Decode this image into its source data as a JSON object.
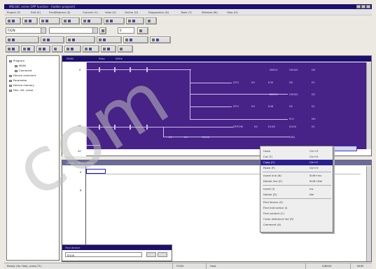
{
  "window": {
    "title": "MELSEC series GPP function - [ladder program]"
  },
  "menu": [
    "Project (F)",
    "Edit (E)",
    "Find/Replace (S)",
    "Convert (C)",
    "View (V)",
    "Online (O)",
    "Diagnostics (D)",
    "Tools (T)",
    "Window (W)",
    "Help (H)"
  ],
  "toolbar": {
    "plc_combo": "FX2N",
    "device_combo": "",
    "step_combo": "0"
  },
  "project_tree": [
    {
      "label": "Program",
      "indent": 0
    },
    {
      "label": "MAIN",
      "indent": 1
    },
    {
      "label": "Comment",
      "indent": 1
    },
    {
      "label": "Device comment",
      "indent": 0
    },
    {
      "label": "Parameter",
      "indent": 0
    },
    {
      "label": "Device memory",
      "indent": 0
    },
    {
      "label": "Dev. init. value",
      "indent": 0
    }
  ],
  "ladder_window": {
    "tabs": [
      "MAIN",
      "Step",
      "Write"
    ]
  },
  "ladder": {
    "step_numbers": [
      "0",
      "10",
      "20"
    ],
    "instructions": [
      {
        "row": 0,
        "text": "DMOV"
      },
      {
        "row": 0,
        "text": "H0000"
      },
      {
        "row": 0,
        "text": "D0"
      },
      {
        "row": 1,
        "text": "DTO"
      },
      {
        "row": 1,
        "text": "K0"
      },
      {
        "row": 1,
        "text": "K30"
      },
      {
        "row": 1,
        "text": "D0"
      },
      {
        "row": 1,
        "text": "K1"
      },
      {
        "row": 2,
        "text": "DMOV"
      },
      {
        "row": 2,
        "text": "H0000"
      },
      {
        "row": 2,
        "text": "D2"
      },
      {
        "row": 3,
        "text": "DTO"
      },
      {
        "row": 3,
        "text": "K0"
      },
      {
        "row": 3,
        "text": "K48"
      },
      {
        "row": 3,
        "text": "D2"
      },
      {
        "row": 3,
        "text": "K1"
      },
      {
        "row": 4,
        "text": "PLS"
      },
      {
        "row": 4,
        "text": "M0"
      },
      {
        "row": 5,
        "text": "DFROM"
      },
      {
        "row": 5,
        "text": "K0"
      },
      {
        "row": 5,
        "text": "K108"
      },
      {
        "row": 5,
        "text": "D100"
      },
      {
        "row": 5,
        "text": "K1"
      },
      {
        "row": 6,
        "text": "K1"
      },
      {
        "row": 6,
        "text": "K4"
      },
      {
        "row": 6,
        "text": "D100"
      },
      {
        "row": 7,
        "text": "END"
      }
    ]
  },
  "lower_window": {
    "title": "Ladder  (Write mode)",
    "step_numbers": [
      "0",
      "6"
    ]
  },
  "context_menu": [
    {
      "label": "Undo",
      "shortcut": "Ctrl+Z",
      "highlight": false
    },
    {
      "label": "Cut (T)",
      "shortcut": "Ctrl+X",
      "highlight": false
    },
    {
      "label": "Copy (C)",
      "shortcut": "Ctrl+C",
      "highlight": true
    },
    {
      "label": "Paste (P)",
      "shortcut": "Ctrl+V",
      "highlight": false
    },
    {
      "sep": true
    },
    {
      "label": "Insert line (N)",
      "shortcut": "Shift+Ins",
      "highlight": false
    },
    {
      "label": "Delete line (E)",
      "shortcut": "Shift+Del",
      "highlight": false
    },
    {
      "sep": true
    },
    {
      "label": "Insert (I)",
      "shortcut": "Ins",
      "highlight": false
    },
    {
      "label": "Delete (D)",
      "shortcut": "Del",
      "highlight": false
    },
    {
      "sep": true
    },
    {
      "label": "Find device (S)",
      "shortcut": "",
      "highlight": false
    },
    {
      "label": "Find instruction (I)",
      "shortcut": "",
      "highlight": false
    },
    {
      "label": "Find contact (C)",
      "shortcut": "",
      "highlight": false
    },
    {
      "label": "Cross reference list (R)",
      "shortcut": "",
      "highlight": false
    },
    {
      "label": "Comment (A)",
      "shortcut": "",
      "highlight": false
    }
  ],
  "small_window": {
    "title": "Find device",
    "value": "D100"
  },
  "status": {
    "message": "Ready (for Help, press F1)",
    "cpu": "FX2N",
    "mode": "Host",
    "step": "0/8000",
    "ovr": "NUM"
  },
  "watermark": "com"
}
